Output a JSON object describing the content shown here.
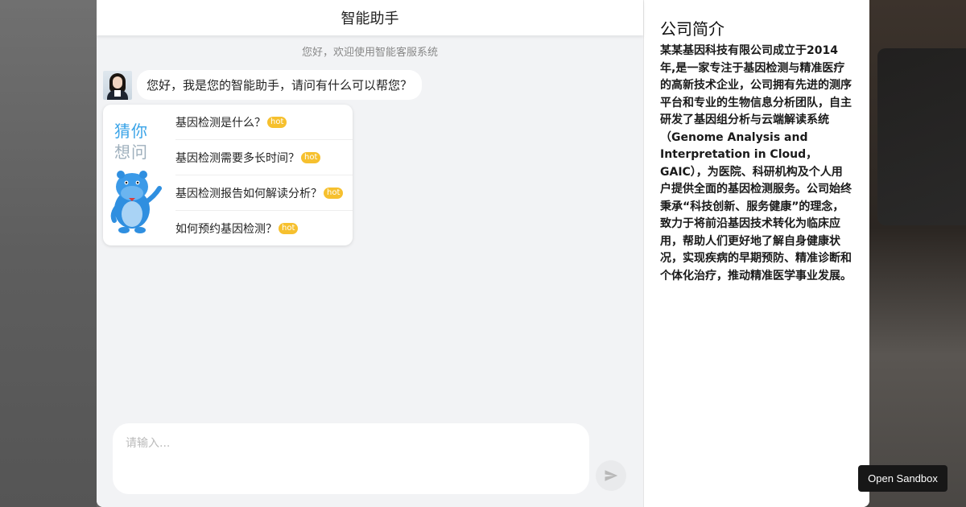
{
  "chat": {
    "title": "智能助手",
    "subtitle": "您好，欢迎使用智能客服系统",
    "greeting": "您好，我是您的智能助手，请问有什么可以帮您？",
    "guess": {
      "title_line1": "猜你",
      "title_line2": "想问",
      "items": [
        {
          "text": "基因检测是什么？",
          "badge": "hot"
        },
        {
          "text": "基因检测需要多长时间？",
          "badge": "hot"
        },
        {
          "text": "基因检测报告如何解读分析？",
          "badge": "hot"
        },
        {
          "text": "如何预约基因检测？",
          "badge": "hot"
        }
      ]
    },
    "input_placeholder": "请输入..."
  },
  "info": {
    "title": "公司简介",
    "body": "某某基因科技有限公司成立于2014年,是一家专注于基因检测与精准医疗的高新技术企业，公司拥有先进的测序平台和专业的生物信息分析团队，自主研发了基因组分析与云端解读系统（Genome Analysis and Interpretation in Cloud，GAIC），为医院、科研机构及个人用户提供全面的基因检测服务。公司始终秉承“科技创新、服务健康”的理念，致力于将前沿基因技术转化为临床应用，帮助人们更好地了解自身健康状况，实现疾病的早期预防、精准诊断和个体化治疗，推动精准医学事业发展。"
  },
  "sandbox_button": "Open Sandbox",
  "colors": {
    "accent": "#3aa4e8",
    "hot_badge": "#f6c02e"
  },
  "icons": {
    "send": "send-icon",
    "mascot": "hippo-mascot-icon"
  }
}
